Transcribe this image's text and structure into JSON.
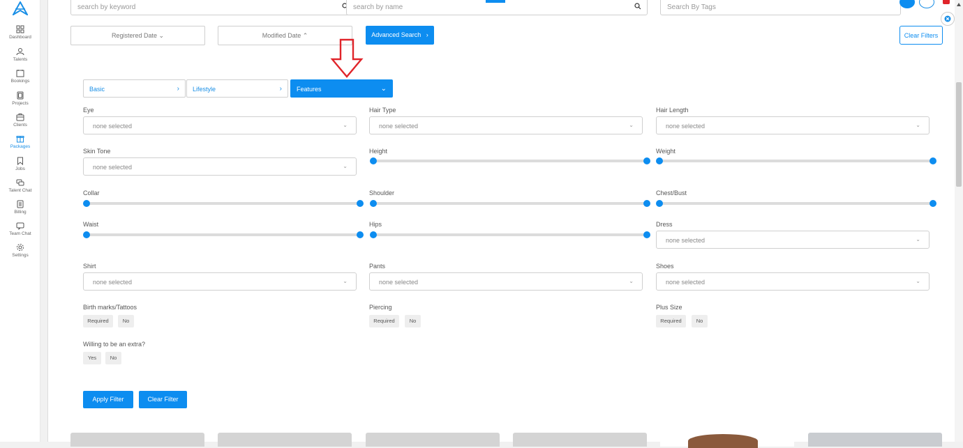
{
  "sidebar": {
    "items": [
      {
        "label": "Dashboard",
        "icon": "dashboard-icon"
      },
      {
        "label": "Talents",
        "icon": "talents-icon"
      },
      {
        "label": "Bookings",
        "icon": "bookings-icon"
      },
      {
        "label": "Projects",
        "icon": "projects-icon"
      },
      {
        "label": "Clients",
        "icon": "clients-icon"
      },
      {
        "label": "Packages",
        "icon": "packages-icon"
      },
      {
        "label": "Jobs",
        "icon": "jobs-icon"
      },
      {
        "label": "Talent Chat",
        "icon": "talent-chat-icon"
      },
      {
        "label": "Billing",
        "icon": "billing-icon"
      },
      {
        "label": "Team Chat",
        "icon": "team-chat-icon"
      },
      {
        "label": "Settings",
        "icon": "settings-icon"
      }
    ],
    "active": "Packages"
  },
  "search": {
    "keyword_placeholder": "search by keyword",
    "name_placeholder": "search by name",
    "tags_placeholder": "Search By Tags"
  },
  "filters": {
    "registered_date": "Registered Date",
    "modified_date": "Modified Date",
    "advanced_search": "Advanced Search",
    "clear_filters": "Clear Filters"
  },
  "tabs": [
    {
      "label": "Basic"
    },
    {
      "label": "Lifestyle"
    },
    {
      "label": "Features"
    }
  ],
  "features": {
    "none_selected": "none selected",
    "eye": "Eye",
    "hair_type": "Hair Type",
    "hair_length": "Hair Length",
    "skin_tone": "Skin Tone",
    "height": "Height",
    "weight": "Weight",
    "collar": "Collar",
    "shoulder": "Shoulder",
    "chest_bust": "Chest/Bust",
    "waist": "Waist",
    "hips": "Hips",
    "dress": "Dress",
    "shirt": "Shirt",
    "pants": "Pants",
    "shoes": "Shoes",
    "birth_marks": "Birth marks/Tattoos",
    "piercing": "Piercing",
    "plus_size": "Plus Size",
    "willing_extra": "Willing to be an extra?",
    "required": "Required",
    "no": "No",
    "yes": "Yes"
  },
  "actions": {
    "apply_filter": "Apply Filter",
    "clear_filter": "Clear Filter"
  },
  "colors": {
    "accent": "#0d8df0",
    "annotation_arrow": "#e0242a"
  }
}
